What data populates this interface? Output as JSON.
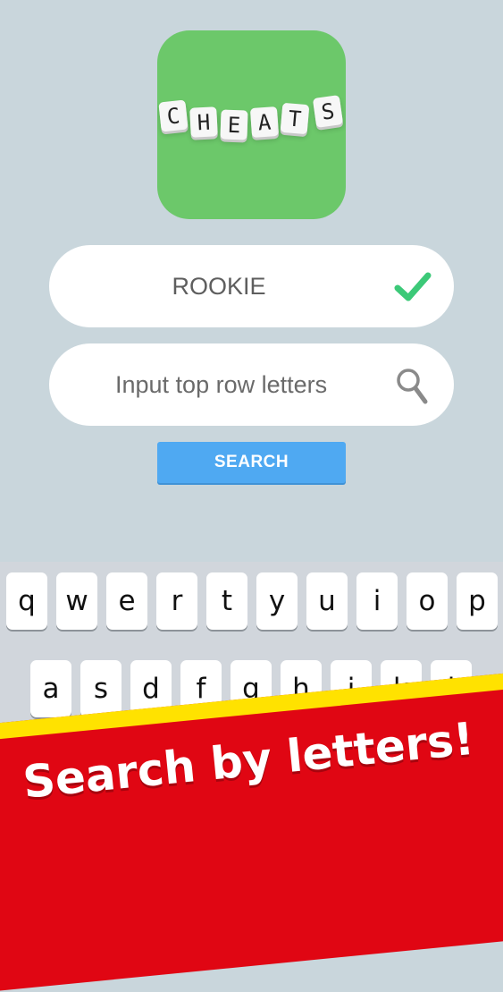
{
  "app_icon": {
    "tiles": [
      "C",
      "H",
      "E",
      "A",
      "T",
      "S"
    ],
    "background_color": "#6cc86a"
  },
  "word_field": {
    "value": "ROOKIE",
    "status_icon": "checkmark-icon",
    "status_color": "#3cc978"
  },
  "letters_field": {
    "placeholder": "Input top row letters",
    "icon": "magnifier-icon"
  },
  "search_button": {
    "label": "SEARCH",
    "color": "#4fa9f2"
  },
  "keyboard": {
    "row1": [
      "q",
      "w",
      "e",
      "r",
      "t",
      "y",
      "u",
      "i",
      "o",
      "p"
    ],
    "row2": [
      "a",
      "s",
      "d",
      "f",
      "g",
      "h",
      "j",
      "k",
      "l"
    ]
  },
  "banner": {
    "text": "Search by letters!",
    "color": "#e00613",
    "stripe_color": "#ffe200"
  }
}
